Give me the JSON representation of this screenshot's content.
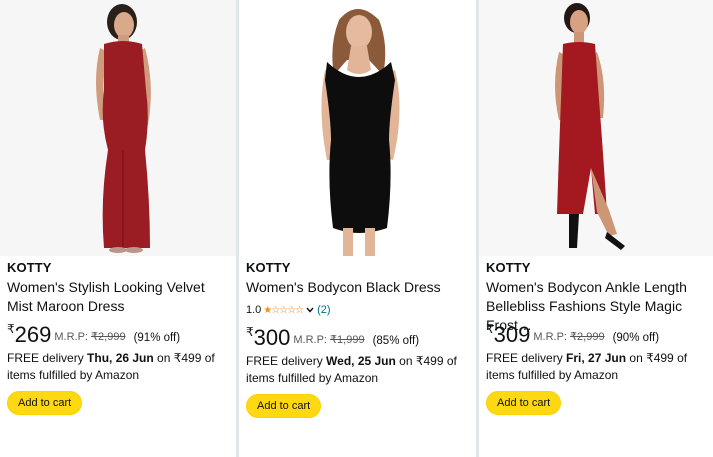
{
  "products": [
    {
      "brand": "KOTTY",
      "title": "Women's Stylish Looking Velvet Mist Maroon Dress",
      "currency": "₹",
      "price": "269",
      "mrp_label": "M.R.P:",
      "mrp": "₹2,999",
      "discount": "(91% off)",
      "delivery_prefix": "FREE delivery ",
      "delivery_date": "Thu, 26 Jun",
      "delivery_suffix": " on ₹499 of items fulfilled by Amazon",
      "cta": "Add to cart",
      "image_icon": "maroon-maxi-dress-image"
    },
    {
      "brand": "KOTTY",
      "title": "Women's Bodycon Black Dress",
      "rating": "1.0",
      "rating_stars": 1,
      "rating_count": "(2)",
      "currency": "₹",
      "price": "300",
      "mrp_label": "M.R.P:",
      "mrp": "₹1,999",
      "discount": "(85% off)",
      "delivery_prefix": "FREE delivery ",
      "delivery_date": "Wed, 25 Jun",
      "delivery_suffix": " on ₹499 of items fulfilled by Amazon",
      "cta": "Add to cart",
      "image_icon": "black-bodycon-dress-image"
    },
    {
      "brand": "KOTTY",
      "title": "Women's Bodycon Ankle Length Bellebliss Fashions Style Magic Frost…",
      "currency": "₹",
      "price": "309",
      "mrp_label": "M.R.P:",
      "mrp": "₹2,999",
      "discount": "(90% off)",
      "delivery_prefix": "FREE delivery ",
      "delivery_date": "Fri, 27 Jun",
      "delivery_suffix": " on ₹499 of items fulfilled by Amazon",
      "cta": "Add to cart",
      "image_icon": "red-halter-slit-dress-image"
    }
  ],
  "colors": {
    "cart_button": "#ffd814",
    "link": "#007185",
    "star": "#ff8f00",
    "muted": "#565959"
  }
}
